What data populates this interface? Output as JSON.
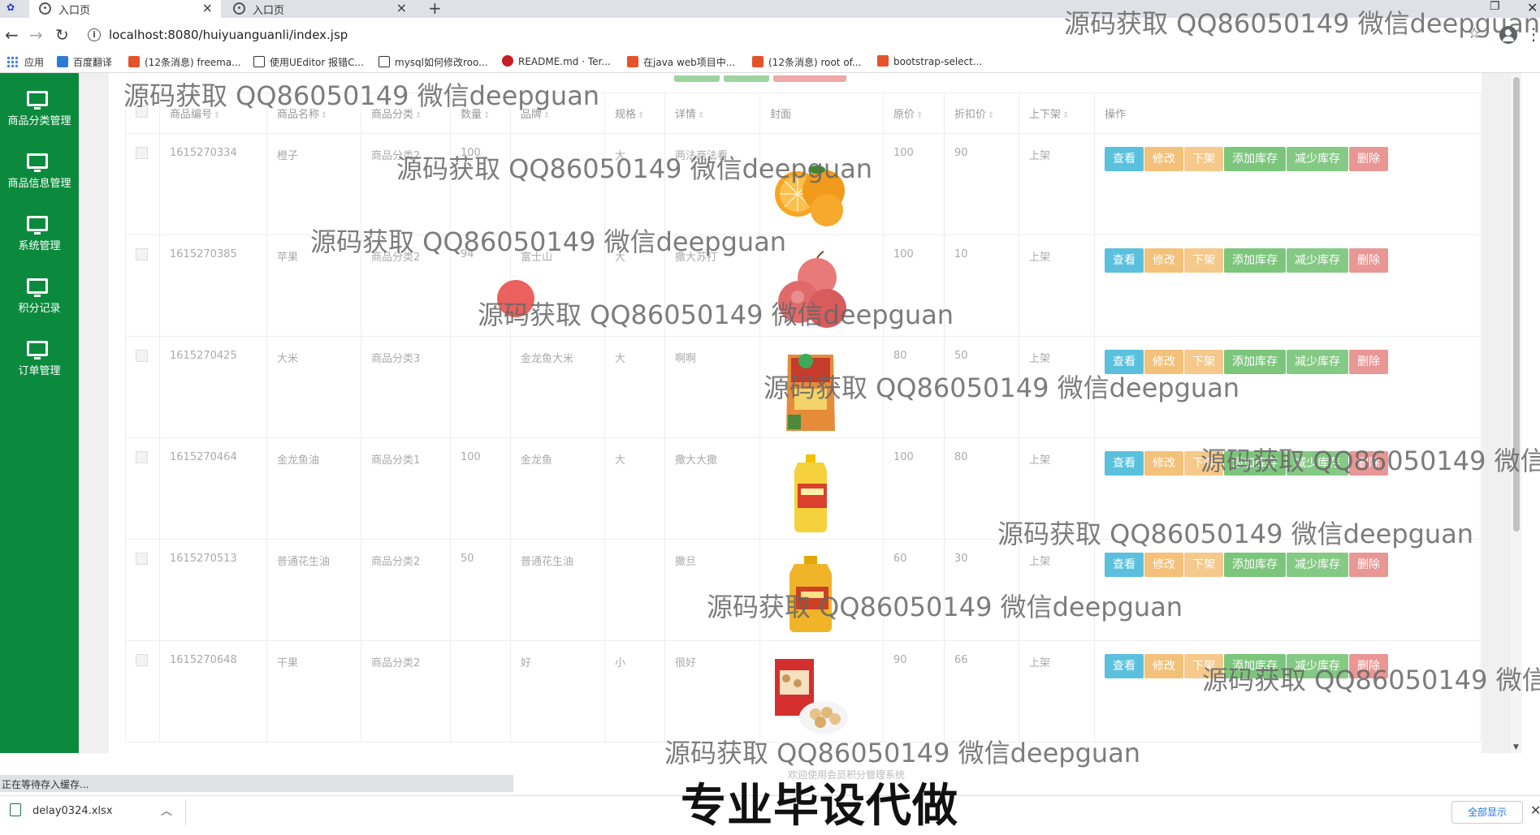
{
  "browser": {
    "tabs": [
      {
        "label": "入口页"
      },
      {
        "label": "入口页"
      }
    ],
    "url": "localhost:8080/huiyuanguanli/index.jsp",
    "bookmarks": [
      "应用",
      "百度翻译",
      "(12条消息) freema...",
      "使用UEditor 报错C...",
      "mysql如何修改roo...",
      "README.md · Ter...",
      "在java web项目中...",
      "(12条消息) root of...",
      "bootstrap-select..."
    ]
  },
  "sidebar": {
    "items": [
      {
        "label": "商品分类管理"
      },
      {
        "label": "商品信息管理"
      },
      {
        "label": "系统管理"
      },
      {
        "label": "积分记录"
      },
      {
        "label": "订单管理"
      }
    ]
  },
  "table": {
    "headers": [
      "商品编号",
      "商品名称",
      "商品分类",
      "数量",
      "品牌",
      "规格",
      "详情",
      "封面",
      "原价",
      "折扣价",
      "上下架",
      "操作"
    ],
    "ops": [
      "查看",
      "修改",
      "下架",
      "添加库存",
      "减少库存",
      "删除"
    ],
    "rows": [
      {
        "id": "1615270334",
        "name": "橙子",
        "cat": "商品分类2",
        "qty": "100",
        "brand": "",
        "spec": "大",
        "detail": "两法商法看",
        "price": "100",
        "discount": "90",
        "status": "上架",
        "img": "orange"
      },
      {
        "id": "1615270385",
        "name": "苹果",
        "cat": "商品分类2",
        "qty": "94",
        "brand": "富士山",
        "spec": "大",
        "detail": "撒大苏打",
        "price": "100",
        "discount": "10",
        "status": "上架",
        "img": "apple"
      },
      {
        "id": "1615270425",
        "name": "大米",
        "cat": "商品分类3",
        "qty": "",
        "brand": "金龙鱼大米",
        "spec": "大",
        "detail": "啊啊",
        "price": "80",
        "discount": "50",
        "status": "上架",
        "img": "rice"
      },
      {
        "id": "1615270464",
        "name": "金龙鱼油",
        "cat": "商品分类1",
        "qty": "100",
        "brand": "金龙鱼",
        "spec": "大",
        "detail": "撒大大撒",
        "price": "100",
        "discount": "80",
        "status": "上架",
        "img": "oil"
      },
      {
        "id": "1615270513",
        "name": "普通花生油",
        "cat": "商品分类2",
        "qty": "50",
        "brand": "普通花生油",
        "spec": "",
        "detail": "撒旦",
        "price": "60",
        "discount": "30",
        "status": "上架",
        "img": "oil2"
      },
      {
        "id": "1615270648",
        "name": "干果",
        "cat": "商品分类2",
        "qty": "",
        "brand": "好",
        "spec": "小",
        "detail": "很好",
        "price": "90",
        "discount": "66",
        "status": "上架",
        "img": "nuts"
      }
    ]
  },
  "footer": {
    "text": "欢迎使用会员积分管理系统"
  },
  "status_tip": "正在等待存入缓存...",
  "downloads": {
    "file": "delay0324.xlsx",
    "show_all": "全部显示"
  },
  "watermark": "源码获取 QQ86050149 微信deepguan",
  "promo": "专业毕设代做",
  "colors": {
    "sidebar": "#0b8a3e",
    "view": "#5bc0de",
    "edit": "#f0ad4e",
    "stock": "#5cb85c",
    "delete": "#d9534f"
  }
}
